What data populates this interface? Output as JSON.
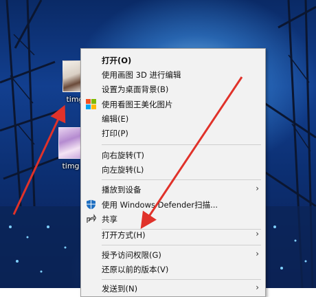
{
  "desktop": {
    "icons": [
      {
        "label": "timg"
      },
      {
        "label": "timg"
      }
    ]
  },
  "context_menu": {
    "items": [
      {
        "label": "打开(O)"
      },
      {
        "label": "使用画图 3D 进行编辑"
      },
      {
        "label": "设置为桌面背景(B)"
      },
      {
        "label": "使用看图王美化图片"
      },
      {
        "label": "编辑(E)"
      },
      {
        "label": "打印(P)"
      },
      {
        "label": "向右旋转(T)"
      },
      {
        "label": "向左旋转(L)"
      },
      {
        "label": "播放到设备"
      },
      {
        "label": "使用 Windows Defender扫描..."
      },
      {
        "label": "共享"
      },
      {
        "label": "打开方式(H)"
      },
      {
        "label": "授予访问权限(G)"
      },
      {
        "label": "还原以前的版本(V)"
      },
      {
        "label": "发送到(N)"
      }
    ]
  },
  "colors": {
    "annotation_arrow": "#e0322a",
    "menu_background": "#f2f2f2",
    "defender_shield": "#1f6fc1"
  },
  "icons": [
    "defender-shield-icon",
    "share-icon",
    "viewer-app-icon",
    "submenu-arrow-icon"
  ]
}
